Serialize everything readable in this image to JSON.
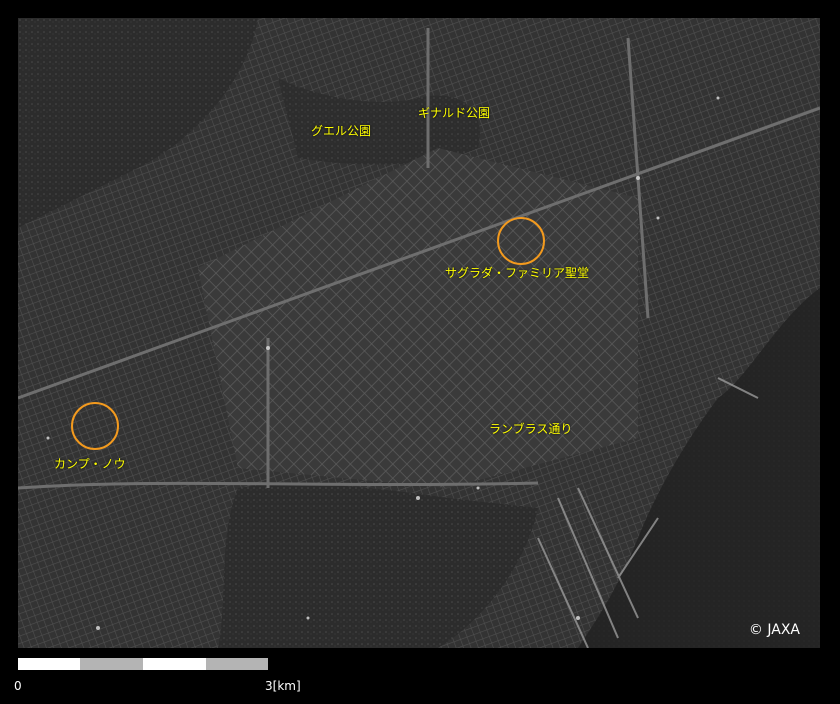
{
  "map": {
    "places": [
      {
        "id": "guell",
        "label": "グエル公園"
      },
      {
        "id": "guinardo",
        "label": "ギナルド公園"
      },
      {
        "id": "sagrada",
        "label": "サグラダ・ファミリア聖堂"
      },
      {
        "id": "ramblas",
        "label": "ランブラス通り"
      },
      {
        "id": "campnou",
        "label": "カンプ・ノウ"
      }
    ],
    "marker_color": "#f39a1e",
    "label_color": "#ffff00",
    "copyright": "© JAXA"
  },
  "scale": {
    "start_label": "0",
    "end_label": "3[km]",
    "segment_colors": [
      "#ffffff",
      "#b4b4b4",
      "#ffffff",
      "#b4b4b4"
    ]
  }
}
